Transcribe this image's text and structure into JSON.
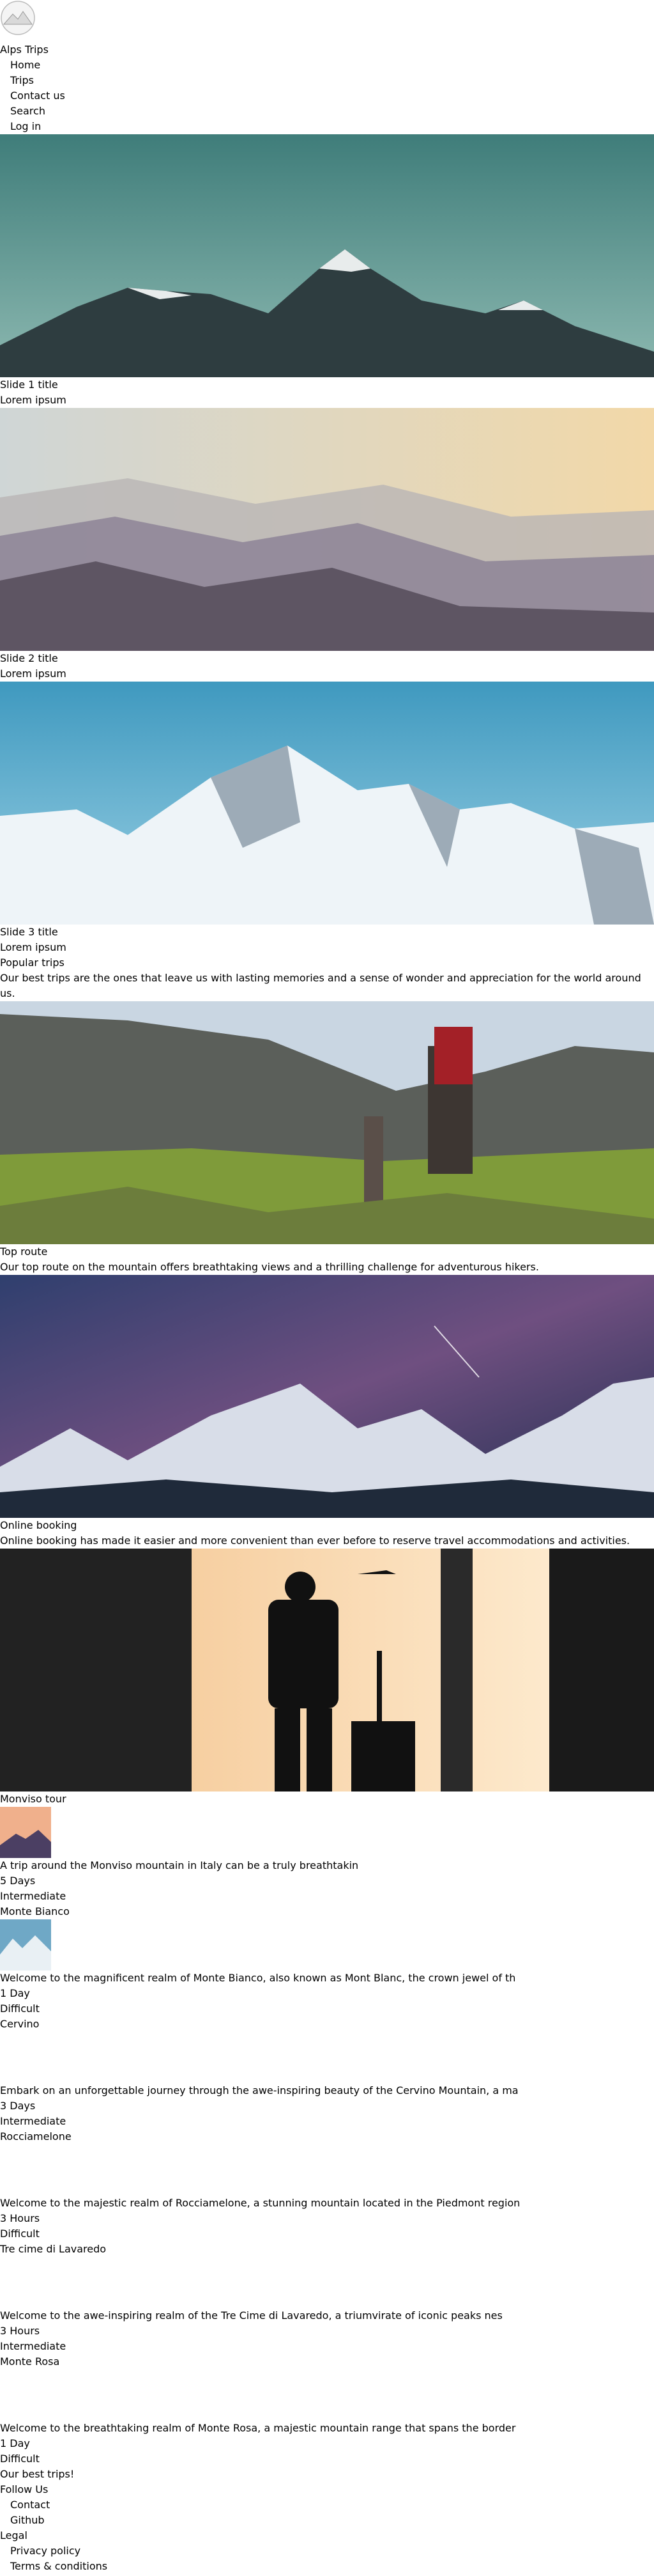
{
  "header": {
    "site_title": "Alps Trips",
    "logo_icon": "mountain-logo-icon",
    "nav": [
      {
        "label": "Home"
      },
      {
        "label": "Trips"
      },
      {
        "label": "Contact us"
      },
      {
        "label": "Search"
      },
      {
        "label": "Log in"
      }
    ]
  },
  "slides": [
    {
      "title": "Slide 1 title",
      "subtitle": "Lorem ipsum"
    },
    {
      "title": "Slide 2 title",
      "subtitle": "Lorem ipsum"
    },
    {
      "title": "Slide 3 title",
      "subtitle": "Lorem ipsum"
    }
  ],
  "popular": {
    "heading": "Popular trips",
    "intro": "Our best trips are the ones that leave us with lasting memories and a sense of wonder and appreciation for the world around us.",
    "cards": [
      {
        "title": "Top route",
        "text": "Our top route on the mountain offers breathtaking views and a thrilling challenge for adventurous hikers."
      },
      {
        "title": "Online booking",
        "text": "Online booking has made it easier and more convenient than ever before to reserve travel accommodations and activities."
      },
      {
        "title": "Monviso tour",
        "text": ""
      }
    ]
  },
  "trips": [
    {
      "name": "Monviso tour",
      "desc": "A trip around the Monviso mountain in Italy can be a truly breathtakin",
      "duration": "5 Days",
      "level": "Intermediate"
    },
    {
      "name": "Monte Bianco",
      "desc": "Welcome to the magnificent realm of Monte Bianco, also known as Mont Blanc, the crown jewel of th",
      "duration": "1 Day",
      "level": "Difficult"
    },
    {
      "name": "Cervino",
      "desc": "Embark on an unforgettable journey through the awe-inspiring beauty of the Cervino Mountain, a ma",
      "duration": "3 Days",
      "level": "Intermediate"
    },
    {
      "name": "Rocciamelone",
      "desc": "Welcome to the majestic realm of Rocciamelone, a stunning mountain located in the Piedmont region",
      "duration": "3 Hours",
      "level": "Difficult"
    },
    {
      "name": "Tre cime di Lavaredo",
      "desc": "Welcome to the awe-inspiring realm of the Tre Cime di Lavaredo, a triumvirate of iconic peaks nes",
      "duration": "3 Hours",
      "level": "Intermediate"
    },
    {
      "name": "Monte Rosa",
      "desc": "Welcome to the breathtaking realm of Monte Rosa, a majestic mountain range that spans the border",
      "duration": "1 Day",
      "level": "Difficult"
    }
  ],
  "footer": {
    "brand": "Our best trips!",
    "follow_heading": "Follow Us",
    "follow_links": [
      {
        "label": "Contact"
      },
      {
        "label": "Github"
      }
    ],
    "legal_heading": "Legal",
    "legal_links": [
      {
        "label": "Privacy policy"
      },
      {
        "label": "Terms & conditions"
      }
    ]
  }
}
